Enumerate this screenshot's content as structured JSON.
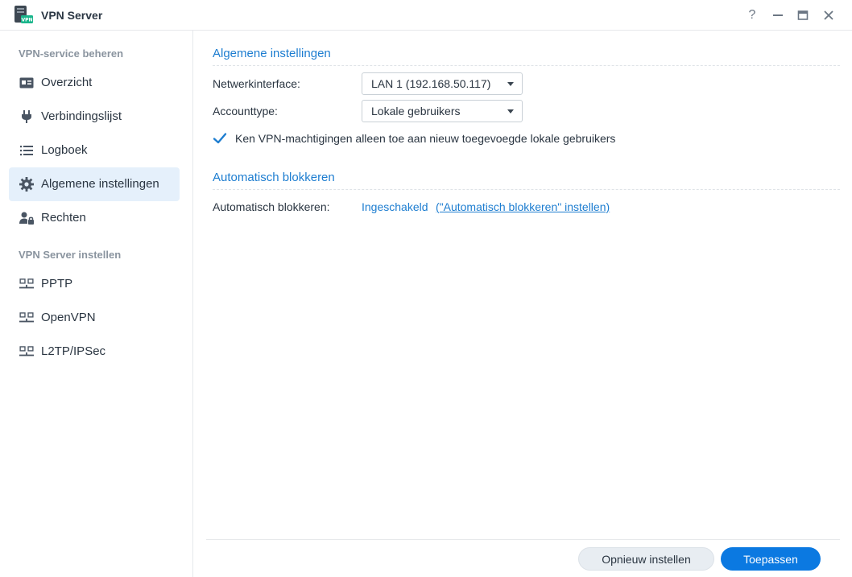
{
  "window": {
    "title": "VPN Server",
    "app_icon_badge": "VPN",
    "help_glyph": "?"
  },
  "sidebar": {
    "section1": "VPN-service beheren",
    "section2": "VPN Server instellen",
    "items": [
      {
        "label": "Overzicht",
        "icon": "overview-card-icon"
      },
      {
        "label": "Verbindingslijst",
        "icon": "plug-icon"
      },
      {
        "label": "Logboek",
        "icon": "list-icon"
      },
      {
        "label": "Algemene instellingen",
        "icon": "gear-icon",
        "active": true
      },
      {
        "label": "Rechten",
        "icon": "user-lock-icon"
      },
      {
        "label": "PPTP",
        "icon": "network-icon"
      },
      {
        "label": "OpenVPN",
        "icon": "network-icon"
      },
      {
        "label": "L2TP/IPSec",
        "icon": "network-icon"
      }
    ]
  },
  "main": {
    "general_title": "Algemene instellingen",
    "network_label": "Netwerkinterface:",
    "network_value": "LAN 1 (192.168.50.117)",
    "account_label": "Accounttype:",
    "account_value": "Lokale gebruikers",
    "checkbox_label": "Ken VPN-machtigingen alleen toe aan nieuw toegevoegde lokale gebruikers",
    "checkbox_checked": true,
    "autoblock_title": "Automatisch blokkeren",
    "autoblock_label": "Automatisch blokkeren:",
    "autoblock_status": "Ingeschakeld",
    "autoblock_link": "(\"Automatisch blokkeren\" instellen)"
  },
  "footer": {
    "reset_label": "Opnieuw instellen",
    "apply_label": "Toepassen"
  },
  "colors": {
    "accent": "#1d7dd0",
    "primary_button": "#0b79e1",
    "active_item": "#e5f0fb"
  }
}
